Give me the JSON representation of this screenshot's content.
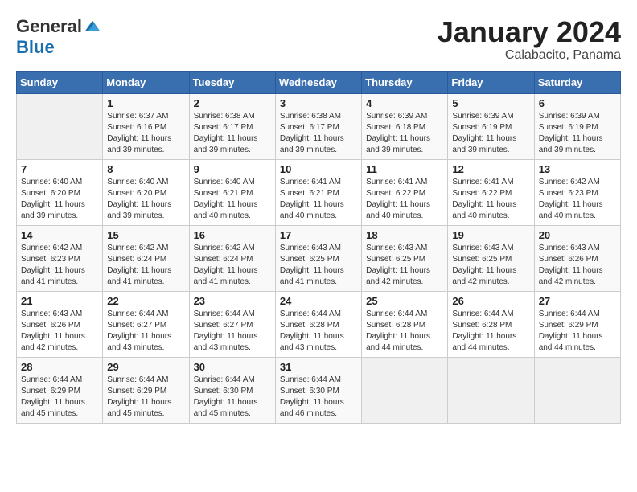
{
  "header": {
    "logo_general": "General",
    "logo_blue": "Blue",
    "month_year": "January 2024",
    "location": "Calabacito, Panama"
  },
  "calendar": {
    "days_of_week": [
      "Sunday",
      "Monday",
      "Tuesday",
      "Wednesday",
      "Thursday",
      "Friday",
      "Saturday"
    ],
    "weeks": [
      [
        {
          "day": "",
          "sunrise": "",
          "sunset": "",
          "daylight": ""
        },
        {
          "day": "1",
          "sunrise": "Sunrise: 6:37 AM",
          "sunset": "Sunset: 6:16 PM",
          "daylight": "Daylight: 11 hours and 39 minutes."
        },
        {
          "day": "2",
          "sunrise": "Sunrise: 6:38 AM",
          "sunset": "Sunset: 6:17 PM",
          "daylight": "Daylight: 11 hours and 39 minutes."
        },
        {
          "day": "3",
          "sunrise": "Sunrise: 6:38 AM",
          "sunset": "Sunset: 6:17 PM",
          "daylight": "Daylight: 11 hours and 39 minutes."
        },
        {
          "day": "4",
          "sunrise": "Sunrise: 6:39 AM",
          "sunset": "Sunset: 6:18 PM",
          "daylight": "Daylight: 11 hours and 39 minutes."
        },
        {
          "day": "5",
          "sunrise": "Sunrise: 6:39 AM",
          "sunset": "Sunset: 6:19 PM",
          "daylight": "Daylight: 11 hours and 39 minutes."
        },
        {
          "day": "6",
          "sunrise": "Sunrise: 6:39 AM",
          "sunset": "Sunset: 6:19 PM",
          "daylight": "Daylight: 11 hours and 39 minutes."
        }
      ],
      [
        {
          "day": "7",
          "sunrise": "Sunrise: 6:40 AM",
          "sunset": "Sunset: 6:20 PM",
          "daylight": "Daylight: 11 hours and 39 minutes."
        },
        {
          "day": "8",
          "sunrise": "Sunrise: 6:40 AM",
          "sunset": "Sunset: 6:20 PM",
          "daylight": "Daylight: 11 hours and 39 minutes."
        },
        {
          "day": "9",
          "sunrise": "Sunrise: 6:40 AM",
          "sunset": "Sunset: 6:21 PM",
          "daylight": "Daylight: 11 hours and 40 minutes."
        },
        {
          "day": "10",
          "sunrise": "Sunrise: 6:41 AM",
          "sunset": "Sunset: 6:21 PM",
          "daylight": "Daylight: 11 hours and 40 minutes."
        },
        {
          "day": "11",
          "sunrise": "Sunrise: 6:41 AM",
          "sunset": "Sunset: 6:22 PM",
          "daylight": "Daylight: 11 hours and 40 minutes."
        },
        {
          "day": "12",
          "sunrise": "Sunrise: 6:41 AM",
          "sunset": "Sunset: 6:22 PM",
          "daylight": "Daylight: 11 hours and 40 minutes."
        },
        {
          "day": "13",
          "sunrise": "Sunrise: 6:42 AM",
          "sunset": "Sunset: 6:23 PM",
          "daylight": "Daylight: 11 hours and 40 minutes."
        }
      ],
      [
        {
          "day": "14",
          "sunrise": "Sunrise: 6:42 AM",
          "sunset": "Sunset: 6:23 PM",
          "daylight": "Daylight: 11 hours and 41 minutes."
        },
        {
          "day": "15",
          "sunrise": "Sunrise: 6:42 AM",
          "sunset": "Sunset: 6:24 PM",
          "daylight": "Daylight: 11 hours and 41 minutes."
        },
        {
          "day": "16",
          "sunrise": "Sunrise: 6:42 AM",
          "sunset": "Sunset: 6:24 PM",
          "daylight": "Daylight: 11 hours and 41 minutes."
        },
        {
          "day": "17",
          "sunrise": "Sunrise: 6:43 AM",
          "sunset": "Sunset: 6:25 PM",
          "daylight": "Daylight: 11 hours and 41 minutes."
        },
        {
          "day": "18",
          "sunrise": "Sunrise: 6:43 AM",
          "sunset": "Sunset: 6:25 PM",
          "daylight": "Daylight: 11 hours and 42 minutes."
        },
        {
          "day": "19",
          "sunrise": "Sunrise: 6:43 AM",
          "sunset": "Sunset: 6:25 PM",
          "daylight": "Daylight: 11 hours and 42 minutes."
        },
        {
          "day": "20",
          "sunrise": "Sunrise: 6:43 AM",
          "sunset": "Sunset: 6:26 PM",
          "daylight": "Daylight: 11 hours and 42 minutes."
        }
      ],
      [
        {
          "day": "21",
          "sunrise": "Sunrise: 6:43 AM",
          "sunset": "Sunset: 6:26 PM",
          "daylight": "Daylight: 11 hours and 42 minutes."
        },
        {
          "day": "22",
          "sunrise": "Sunrise: 6:44 AM",
          "sunset": "Sunset: 6:27 PM",
          "daylight": "Daylight: 11 hours and 43 minutes."
        },
        {
          "day": "23",
          "sunrise": "Sunrise: 6:44 AM",
          "sunset": "Sunset: 6:27 PM",
          "daylight": "Daylight: 11 hours and 43 minutes."
        },
        {
          "day": "24",
          "sunrise": "Sunrise: 6:44 AM",
          "sunset": "Sunset: 6:28 PM",
          "daylight": "Daylight: 11 hours and 43 minutes."
        },
        {
          "day": "25",
          "sunrise": "Sunrise: 6:44 AM",
          "sunset": "Sunset: 6:28 PM",
          "daylight": "Daylight: 11 hours and 44 minutes."
        },
        {
          "day": "26",
          "sunrise": "Sunrise: 6:44 AM",
          "sunset": "Sunset: 6:28 PM",
          "daylight": "Daylight: 11 hours and 44 minutes."
        },
        {
          "day": "27",
          "sunrise": "Sunrise: 6:44 AM",
          "sunset": "Sunset: 6:29 PM",
          "daylight": "Daylight: 11 hours and 44 minutes."
        }
      ],
      [
        {
          "day": "28",
          "sunrise": "Sunrise: 6:44 AM",
          "sunset": "Sunset: 6:29 PM",
          "daylight": "Daylight: 11 hours and 45 minutes."
        },
        {
          "day": "29",
          "sunrise": "Sunrise: 6:44 AM",
          "sunset": "Sunset: 6:29 PM",
          "daylight": "Daylight: 11 hours and 45 minutes."
        },
        {
          "day": "30",
          "sunrise": "Sunrise: 6:44 AM",
          "sunset": "Sunset: 6:30 PM",
          "daylight": "Daylight: 11 hours and 45 minutes."
        },
        {
          "day": "31",
          "sunrise": "Sunrise: 6:44 AM",
          "sunset": "Sunset: 6:30 PM",
          "daylight": "Daylight: 11 hours and 46 minutes."
        },
        {
          "day": "",
          "sunrise": "",
          "sunset": "",
          "daylight": ""
        },
        {
          "day": "",
          "sunrise": "",
          "sunset": "",
          "daylight": ""
        },
        {
          "day": "",
          "sunrise": "",
          "sunset": "",
          "daylight": ""
        }
      ]
    ]
  }
}
